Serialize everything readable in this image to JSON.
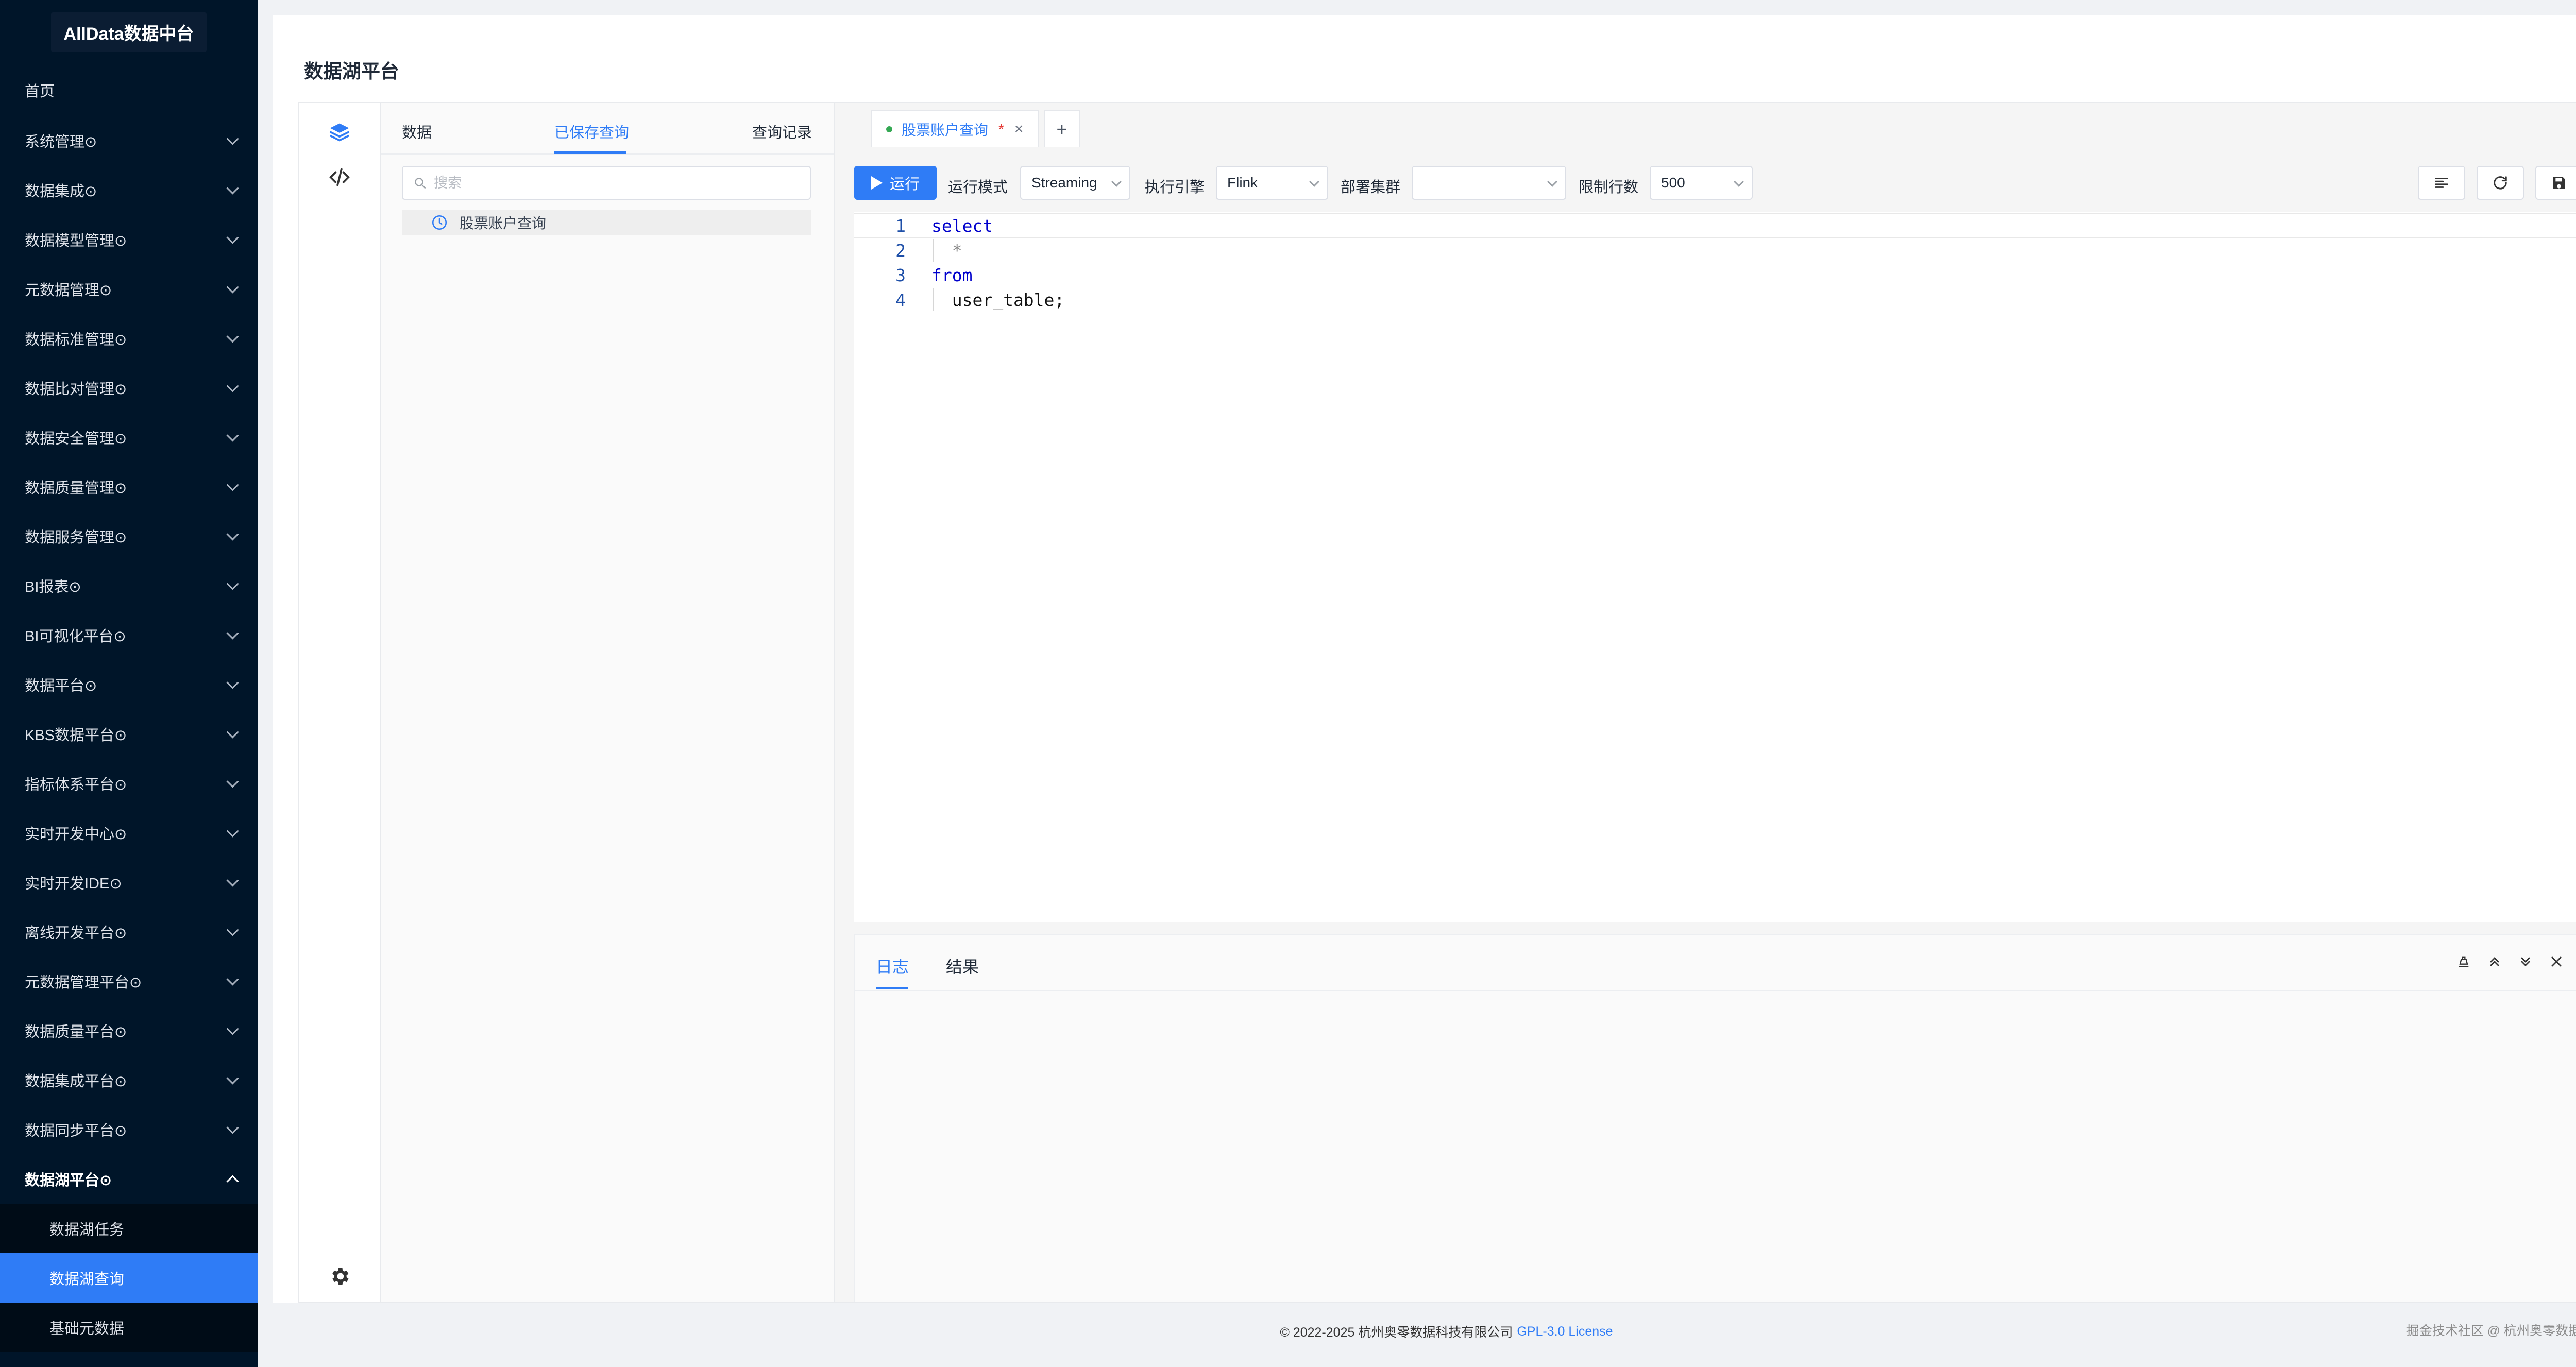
{
  "sidebar": {
    "logo": "AllData数据中台",
    "home": "首页",
    "items": [
      "系统管理⊙",
      "数据集成⊙",
      "数据模型管理⊙",
      "元数据管理⊙",
      "数据标准管理⊙",
      "数据比对管理⊙",
      "数据安全管理⊙",
      "数据质量管理⊙",
      "数据服务管理⊙",
      "BI报表⊙",
      "BI可视化平台⊙",
      "数据平台⊙",
      "KBS数据平台⊙",
      "指标体系平台⊙",
      "实时开发中心⊙",
      "实时开发IDE⊙",
      "离线开发平台⊙",
      "元数据管理平台⊙",
      "数据质量平台⊙",
      "数据集成平台⊙",
      "数据同步平台⊙"
    ],
    "open_item": "数据湖平台⊙",
    "sub_items": [
      "数据湖任务",
      "数据湖查询",
      "基础元数据"
    ],
    "active_sub": "数据湖查询"
  },
  "page": {
    "title": "数据湖平台"
  },
  "left_panel": {
    "tabs": [
      "数据",
      "已保存查询",
      "查询记录"
    ],
    "active_tab": "已保存查询",
    "search_placeholder": "搜索",
    "saved_queries": [
      "股票账户查询"
    ]
  },
  "editor": {
    "tab_label": "股票账户查询",
    "tab_modified_marker": "*",
    "tab_close": "×",
    "tab_add": "+",
    "toolbar": {
      "run": "运行",
      "mode_label": "运行模式",
      "mode_value": "Streaming",
      "engine_label": "执行引擎",
      "engine_value": "Flink",
      "cluster_label": "部署集群",
      "cluster_value": "",
      "limit_label": "限制行数",
      "limit_value": "500"
    },
    "code": [
      {
        "ln": "1",
        "text": "select",
        "keyword": true
      },
      {
        "ln": "2",
        "text": "  *",
        "keyword": false
      },
      {
        "ln": "3",
        "text": "from",
        "keyword": true
      },
      {
        "ln": "4",
        "text": "  user_table;",
        "keyword": false
      }
    ]
  },
  "bottom_panel": {
    "tabs": [
      "日志",
      "结果"
    ],
    "active_tab": "日志"
  },
  "footer": {
    "copyright": "© 2022-2025 杭州奥零数据科技有限公司",
    "license": "GPL-3.0 License",
    "right_text": "掘金技术社区 @ 杭州奥零数据科技"
  },
  "colors": {
    "sidebar_bg": "#001529",
    "accent": "#2f7cf6",
    "status_dot": "#34a853",
    "modified": "#e53935"
  }
}
